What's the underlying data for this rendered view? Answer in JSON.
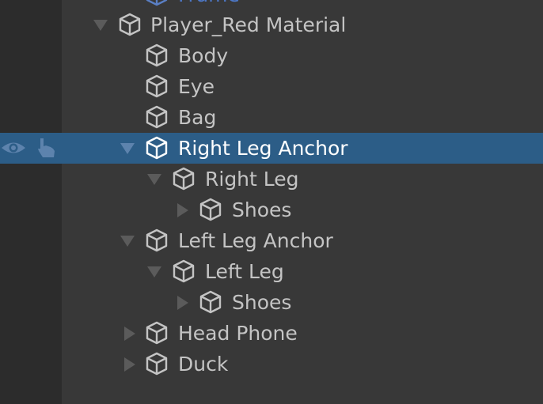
{
  "hierarchy": {
    "partial_top_label": "Frame",
    "rows": [
      {
        "label": "Player_Red Material",
        "expanded": true,
        "has_children": true,
        "depth": 0
      },
      {
        "label": "Body",
        "expanded": false,
        "has_children": false,
        "depth": 1
      },
      {
        "label": "Eye",
        "expanded": false,
        "has_children": false,
        "depth": 1
      },
      {
        "label": "Bag",
        "expanded": false,
        "has_children": false,
        "depth": 1
      },
      {
        "label": "Right Leg Anchor",
        "expanded": true,
        "has_children": true,
        "depth": 1,
        "selected": true
      },
      {
        "label": "Right Leg",
        "expanded": true,
        "has_children": true,
        "depth": 2
      },
      {
        "label": "Shoes",
        "expanded": false,
        "has_children": true,
        "depth": 3
      },
      {
        "label": "Left Leg Anchor",
        "expanded": true,
        "has_children": true,
        "depth": 1
      },
      {
        "label": "Left Leg",
        "expanded": true,
        "has_children": true,
        "depth": 2
      },
      {
        "label": "Shoes",
        "expanded": false,
        "has_children": true,
        "depth": 3
      },
      {
        "label": "Head Phone",
        "expanded": false,
        "has_children": true,
        "depth": 1
      },
      {
        "label": "Duck",
        "expanded": false,
        "has_children": true,
        "depth": 1
      }
    ]
  },
  "gutter_icons": {
    "visibility": "eye-icon",
    "pickability": "hand-pointer-icon"
  },
  "colors": {
    "background": "#383838",
    "gutter": "#2c2c2c",
    "selection": "#2c5d87",
    "text": "#c4c4c4",
    "text_selected": "#ffffff",
    "text_prefab_link": "#4d78c8"
  }
}
